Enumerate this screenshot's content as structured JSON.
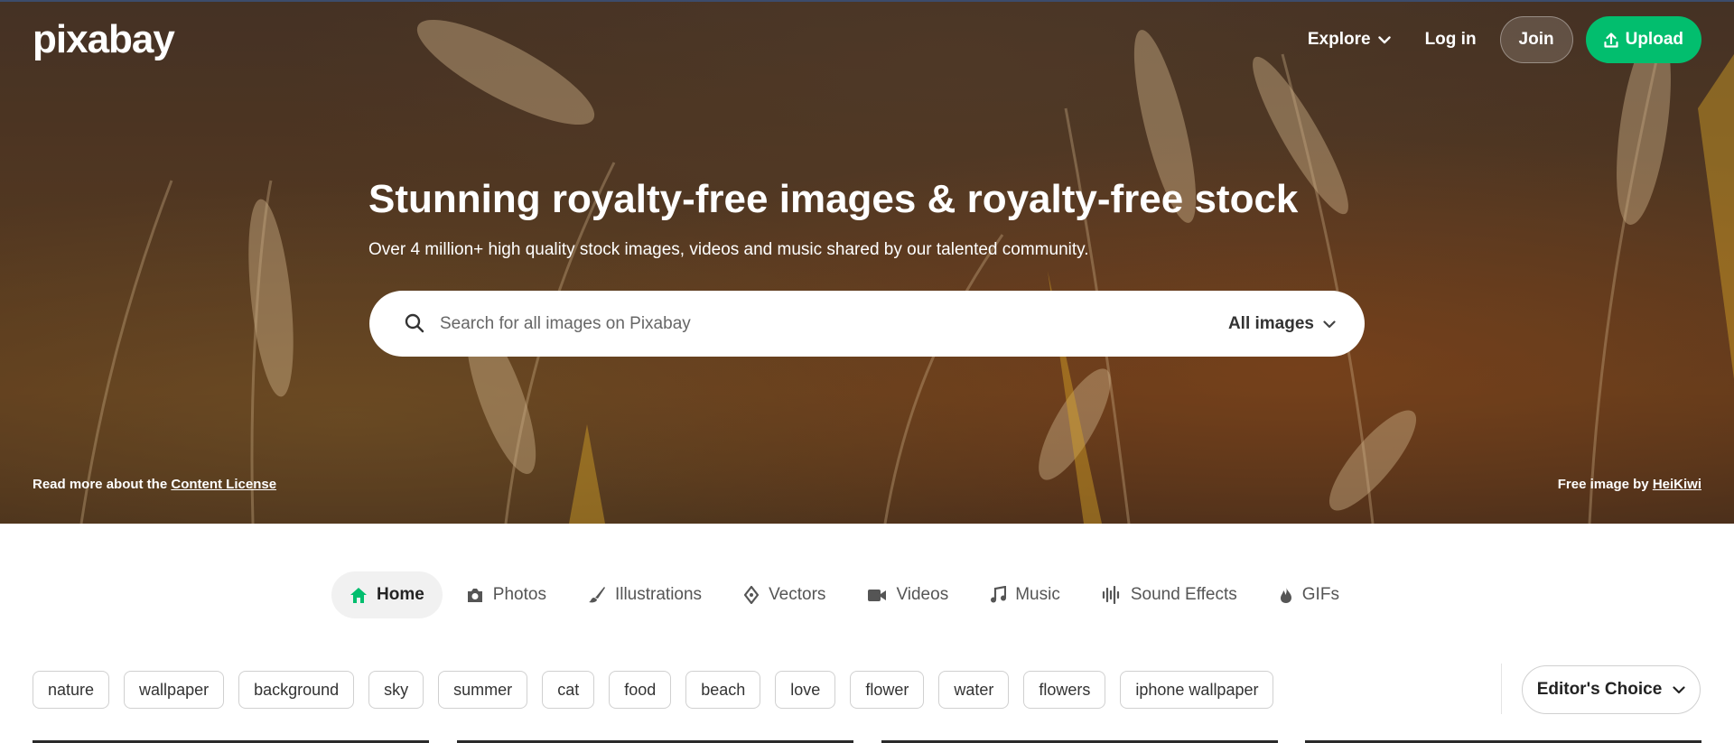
{
  "brand": {
    "logo_text": "pixabay",
    "accent": "#02be6e"
  },
  "nav": {
    "explore_label": "Explore",
    "login_label": "Log in",
    "join_label": "Join",
    "upload_label": "Upload"
  },
  "hero": {
    "title": "Stunning royalty-free images & royalty-free stock",
    "subtitle": "Over 4 million+ high quality stock images, videos and music shared by our talented community.",
    "license_prefix": "Read more about the",
    "license_link": "Content License",
    "credit_prefix": "Free image by",
    "credit_author": "HeiKiwi"
  },
  "search": {
    "placeholder": "Search for all images on Pixabay",
    "filter_label": "All images"
  },
  "tabs": [
    {
      "label": "Home",
      "icon": "home-icon",
      "active": true
    },
    {
      "label": "Photos",
      "icon": "camera-icon"
    },
    {
      "label": "Illustrations",
      "icon": "brush-icon"
    },
    {
      "label": "Vectors",
      "icon": "pen-nib-icon"
    },
    {
      "label": "Videos",
      "icon": "video-camera-icon"
    },
    {
      "label": "Music",
      "icon": "music-note-icon"
    },
    {
      "label": "Sound Effects",
      "icon": "sound-wave-icon"
    },
    {
      "label": "GIFs",
      "icon": "flame-icon"
    }
  ],
  "tags": [
    "nature",
    "wallpaper",
    "background",
    "sky",
    "summer",
    "cat",
    "food",
    "beach",
    "love",
    "flower",
    "water",
    "flowers",
    "iphone wallpaper"
  ],
  "sort": {
    "selected": "Editor's Choice"
  }
}
